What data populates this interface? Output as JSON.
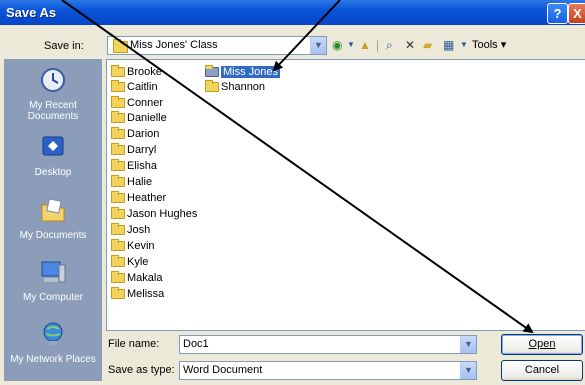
{
  "title": "Save As",
  "title_buttons": {
    "help": "?",
    "close": "X"
  },
  "save_in": {
    "label": "Save in:",
    "value": "Miss Jones' Class"
  },
  "toolbar": {
    "tools_label": "Tools"
  },
  "places": [
    {
      "label": "My Recent Documents",
      "icon": "recent-documents-icon"
    },
    {
      "label": "Desktop",
      "icon": "desktop-icon"
    },
    {
      "label": "My Documents",
      "icon": "my-documents-icon"
    },
    {
      "label": "My Computer",
      "icon": "my-computer-icon"
    },
    {
      "label": "My Network Places",
      "icon": "network-places-icon"
    }
  ],
  "files_col1": [
    "Brooke",
    "Caitlin",
    "Conner",
    "Danielle",
    "Darion",
    "Darryl",
    "Elisha",
    "Halie",
    "Heather",
    "Jason Hughes",
    "Josh",
    "Kevin",
    "Kyle",
    "Makala",
    "Melissa"
  ],
  "files_col2": [
    "Miss Jones",
    "Shannon"
  ],
  "selected_item": "Miss Jones",
  "file_name": {
    "label": "File name:",
    "value": "Doc1"
  },
  "save_as_type": {
    "label": "Save as type:",
    "value": "Word Document"
  },
  "buttons": {
    "open": "Open",
    "cancel": "Cancel"
  }
}
